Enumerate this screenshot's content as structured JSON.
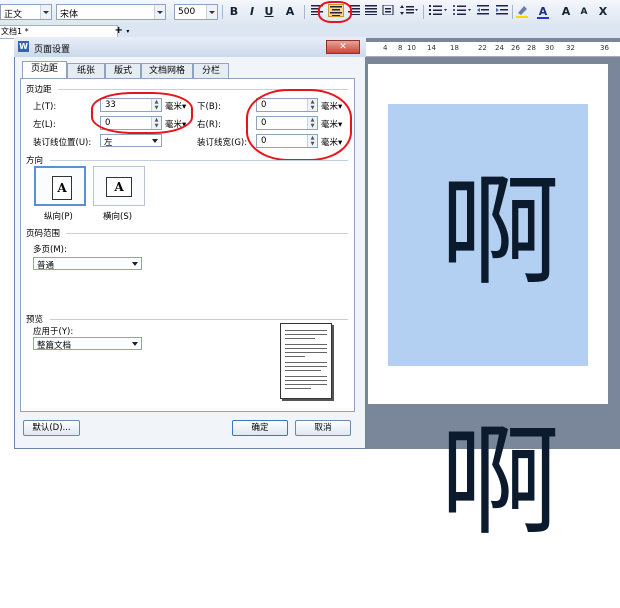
{
  "toolbar": {
    "style": "正文",
    "font": "宋体",
    "size": "500",
    "bold": "B",
    "italic": "I",
    "underline": "U",
    "font_effect": "A",
    "font_color": "A",
    "grow_font": "A",
    "shrink_font": "A",
    "clear_format": "X"
  },
  "doc_tab": "文档1 *",
  "ruler": [
    "4",
    "8",
    "10",
    "14",
    "18",
    "22",
    "24",
    "26",
    "28",
    "30",
    "32",
    "36"
  ],
  "document_text": "啊啊",
  "dialog": {
    "title": "页面设置",
    "close": "✕",
    "tabs": [
      "页边距",
      "纸张",
      "版式",
      "文档网格",
      "分栏"
    ],
    "margins": {
      "section": "页边距",
      "top_label": "上(T):",
      "top_value": "33",
      "top_unit": "毫米",
      "bottom_label": "下(B):",
      "bottom_value": "0",
      "bottom_unit": "毫米",
      "left_label": "左(L):",
      "left_value": "0",
      "left_unit": "毫米",
      "right_label": "右(R):",
      "right_value": "0",
      "right_unit": "毫米",
      "gutter_pos_label": "装订线位置(U):",
      "gutter_pos_value": "左",
      "gutter_width_label": "装订线宽(G):",
      "gutter_width_value": "0",
      "gutter_width_unit": "毫米"
    },
    "orientation": {
      "section": "方向",
      "portrait": "纵向(P)",
      "landscape": "横向(S)",
      "glyph": "A"
    },
    "pages": {
      "section": "页码范围",
      "multi_label": "多页(M):",
      "multi_value": "普通"
    },
    "preview": {
      "section": "预览",
      "apply_label": "应用于(Y):",
      "apply_value": "整篇文档"
    },
    "buttons": {
      "default": "默认(D)...",
      "ok": "确定",
      "cancel": "取消"
    }
  }
}
